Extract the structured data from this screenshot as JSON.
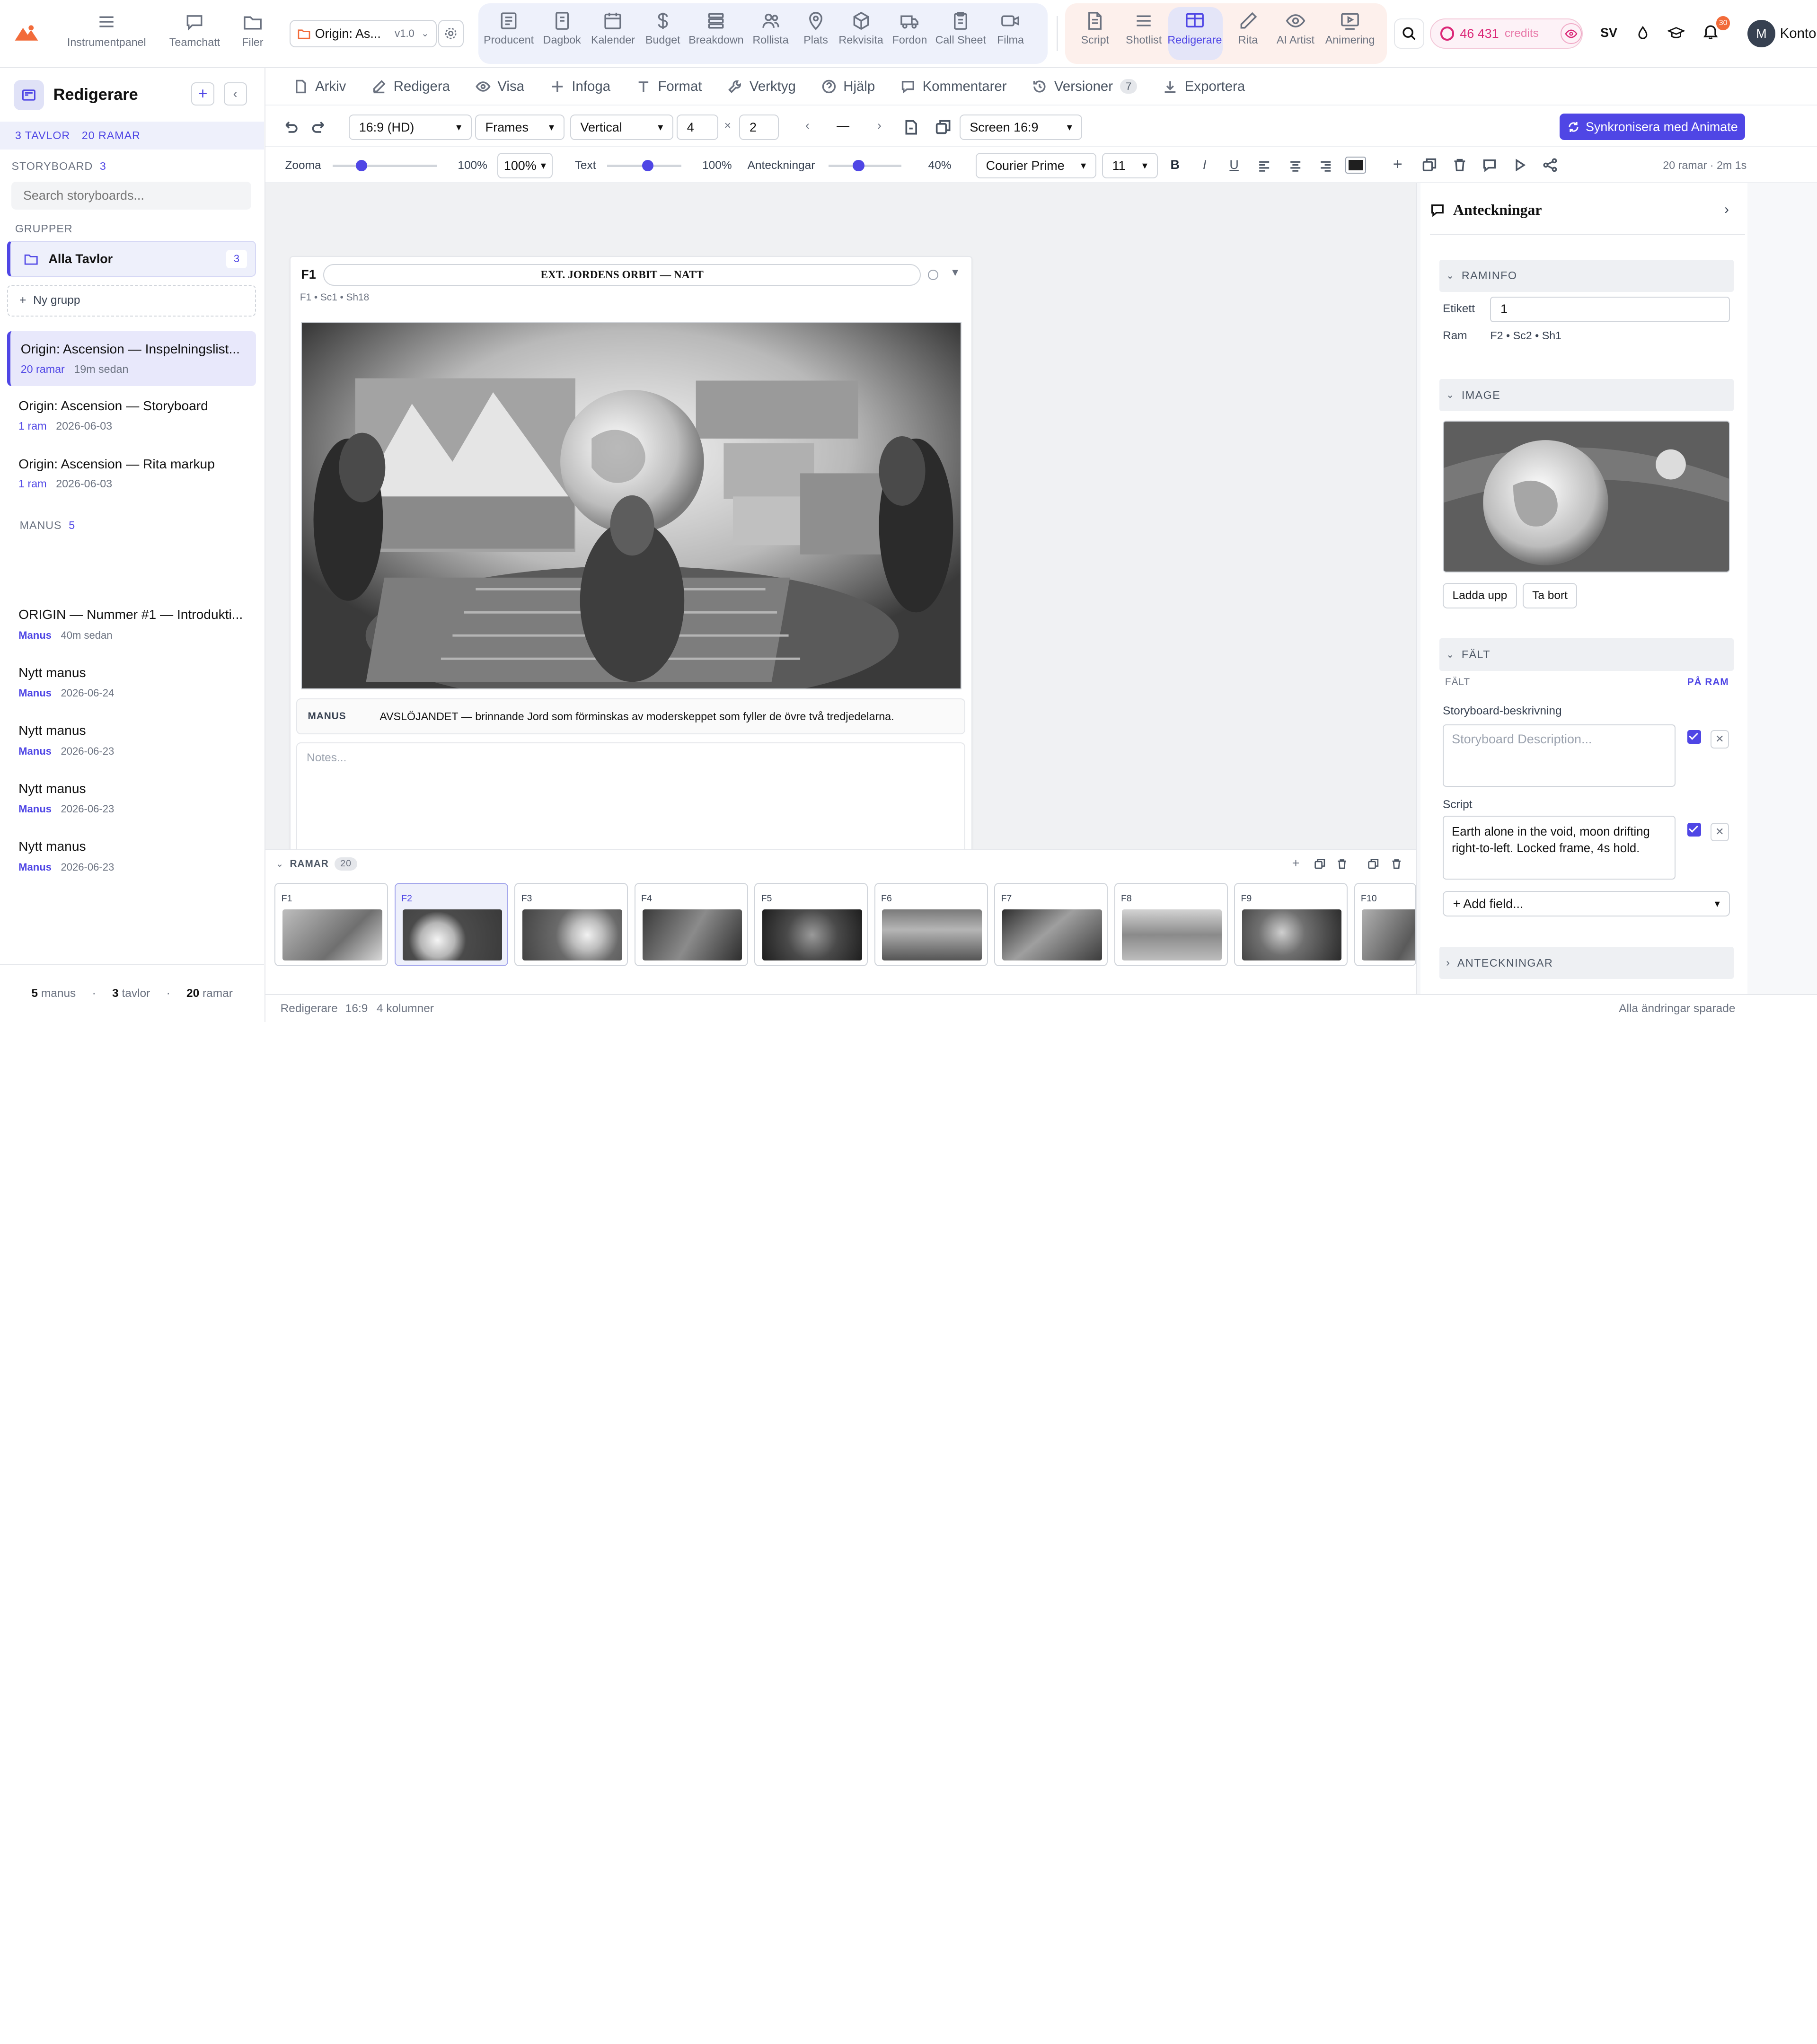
{
  "topbar": {
    "nav_left": [
      {
        "label": "Instrumentpanel",
        "icon": "hamburger-icon"
      },
      {
        "label": "Teamchatt",
        "icon": "chat-icon"
      },
      {
        "label": "Filer",
        "icon": "folder-icon"
      }
    ],
    "project": {
      "name": "Origin: As...",
      "version": "v1.0"
    },
    "nav_tools": [
      {
        "label": "Producent",
        "icon": "producer-icon"
      },
      {
        "label": "Dagbok",
        "icon": "journal-icon"
      },
      {
        "label": "Kalender",
        "icon": "calendar-icon"
      },
      {
        "label": "Budget",
        "icon": "dollar-icon"
      },
      {
        "label": "Breakdown",
        "icon": "list-icon"
      },
      {
        "label": "Rollista",
        "icon": "people-icon"
      },
      {
        "label": "Plats",
        "icon": "location-pin-icon"
      },
      {
        "label": "Rekvisita",
        "icon": "box-icon"
      },
      {
        "label": "Fordon",
        "icon": "truck-icon"
      },
      {
        "label": "Call Sheet",
        "icon": "clipboard-icon"
      },
      {
        "label": "Filma",
        "icon": "video-camera-icon"
      }
    ],
    "nav_create": [
      {
        "label": "Script",
        "icon": "document-icon"
      },
      {
        "label": "Shotlist",
        "icon": "lines-icon"
      },
      {
        "label": "Redigerare",
        "icon": "storyboard-icon",
        "active": true
      },
      {
        "label": "Rita",
        "icon": "pencil-icon"
      },
      {
        "label": "AI Artist",
        "icon": "eye-icon"
      },
      {
        "label": "Animering",
        "icon": "play-screen-icon"
      }
    ],
    "credits": {
      "amount": "46 431",
      "unit": "credits"
    },
    "language": "SV",
    "notifications": "30",
    "user": {
      "initial": "M",
      "name": "Konto"
    }
  },
  "sidebar": {
    "title": "Redigerare",
    "counts": {
      "boards": "3 TAVLOR",
      "frames": "20 RAMAR"
    },
    "storyboard_label": "STORYBOARD",
    "storyboard_count": "3",
    "search_placeholder": "Search storyboards...",
    "groups_label": "GRUPPER",
    "all_boards": {
      "label": "Alla Tavlor",
      "count": "3"
    },
    "new_group": "Ny grupp",
    "boards": [
      {
        "title": "Origin: Ascension — Inspelningslist...",
        "meta1": "20 ramar",
        "meta2": "19m sedan",
        "active": true
      },
      {
        "title": "Origin: Ascension — Storyboard",
        "meta1": "1 ram",
        "meta2": "2026-06-03"
      },
      {
        "title": "Origin: Ascension — Rita markup",
        "meta1": "1 ram",
        "meta2": "2026-06-03"
      }
    ],
    "scripts_label": "MANUS",
    "scripts_count": "5",
    "scripts": [
      {
        "title": "ORIGIN — Nummer #1 — Introdukti...",
        "tag": "Manus",
        "date": "40m sedan"
      },
      {
        "title": "Nytt manus",
        "tag": "Manus",
        "date": "2026-06-24"
      },
      {
        "title": "Nytt manus",
        "tag": "Manus",
        "date": "2026-06-23"
      },
      {
        "title": "Nytt manus",
        "tag": "Manus",
        "date": "2026-06-23"
      },
      {
        "title": "Nytt manus",
        "tag": "Manus",
        "date": "2026-06-23"
      }
    ],
    "footer": {
      "scripts_n": "5",
      "scripts_l": "manus",
      "boards_n": "3",
      "boards_l": "tavlor",
      "frames_n": "20",
      "frames_l": "ramar"
    }
  },
  "menubar": [
    {
      "label": "Arkiv",
      "icon": "file-icon"
    },
    {
      "label": "Redigera",
      "icon": "edit-icon"
    },
    {
      "label": "Visa",
      "icon": "eye-icon"
    },
    {
      "label": "Infoga",
      "icon": "plus-icon"
    },
    {
      "label": "Format",
      "icon": "text-format-icon"
    },
    {
      "label": "Verktyg",
      "icon": "wrench-icon"
    },
    {
      "label": "Hjälp",
      "icon": "help-icon"
    },
    {
      "label": "Kommentarer",
      "icon": "comment-icon"
    },
    {
      "label": "Versioner",
      "icon": "history-icon",
      "badge": "7"
    },
    {
      "label": "Exportera",
      "icon": "download-icon"
    }
  ],
  "toolbar": {
    "aspect": "16:9 (HD)",
    "mode": "Frames",
    "orientation": "Vertical",
    "cols": "4",
    "times": "×",
    "rows": "2",
    "dash": "—",
    "screen": "Screen 16:9",
    "sync_button": "Synkronisera med Animate",
    "zoom_label": "Zooma",
    "zoom_pct": "100%",
    "zoom_select": "100%",
    "text_label": "Text",
    "text_pct": "100%",
    "notes_label": "Anteckningar",
    "notes_pct": "40%",
    "font": "Courier Prime",
    "font_size": "11",
    "summary": "20 ramar · 2m 1s"
  },
  "frame_card": {
    "id": "F1",
    "heading": "EXT. JORDENS ORBIT — NATT",
    "sub": "F1 • Sc1 • Sh18",
    "manus_label": "MANUS",
    "manus_text": "AVSLÖJANDET — brinnande Jord som förminskas av moderskeppet som fyller de övre två tredjedelarna.",
    "notes_placeholder": "Notes..."
  },
  "strip": {
    "label": "RAMAR",
    "count": "20",
    "frames": [
      "F1",
      "F2",
      "F3",
      "F4",
      "F5",
      "F6",
      "F7",
      "F8",
      "F9",
      "F10"
    ],
    "selected": "F2"
  },
  "rightpanel": {
    "title": "Anteckningar",
    "frameinfo_label": "RAMINFO",
    "etikett_label": "Etikett",
    "etikett_value": "1",
    "ram_label": "Ram",
    "ram_value": "F2 • Sc2 • Sh1",
    "image_label": "IMAGE",
    "upload": "Ladda upp",
    "remove": "Ta bort",
    "fields_label": "FÄLT",
    "fields_col1": "FÄLT",
    "fields_col2": "PÅ RAM",
    "desc_label": "Storyboard-beskrivning",
    "desc_placeholder": "Storyboard Description...",
    "script_label": "Script",
    "script_value": "Earth alone in the void, moon drifting right-to-left. Locked frame, 4s hold.",
    "add_field": "+ Add field...",
    "notes_label": "ANTECKNINGAR"
  },
  "statusbar": {
    "mode": "Redigerare",
    "aspect": "16:9",
    "columns": "4 kolumner",
    "saved": "Alla ändringar sparade"
  },
  "colors": {
    "accent": "#4f46e5",
    "active_bg": "#e8e8fb",
    "credits": "#db2777",
    "create_group": "#fdf0ec",
    "tools_group": "#eef1fb"
  }
}
